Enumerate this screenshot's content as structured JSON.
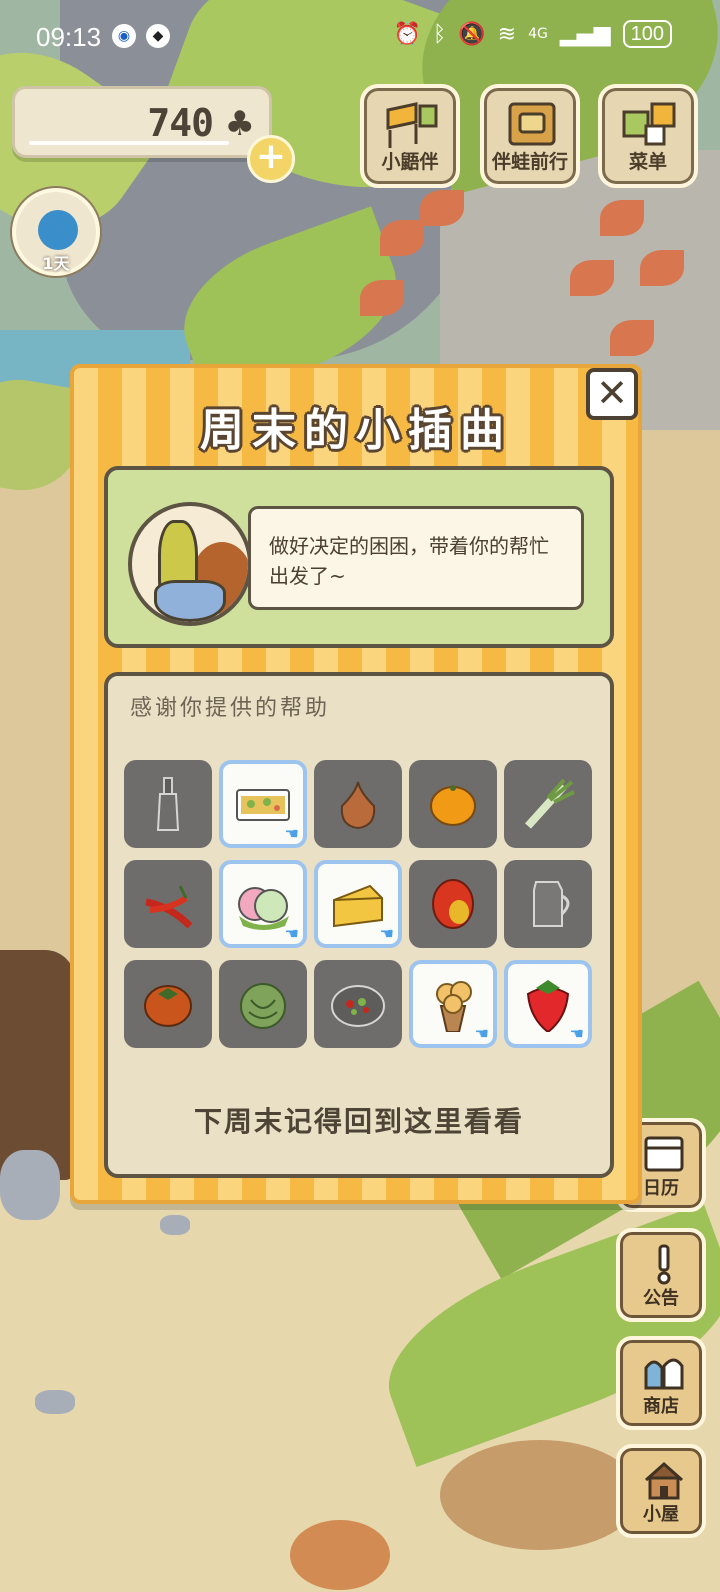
{
  "status_bar": {
    "time": "09:13",
    "app_icons": [
      "browser-icon",
      "qq-icon"
    ],
    "network": "4G",
    "battery": "100"
  },
  "hud": {
    "clover_count": "740",
    "clover_symbol": "♣",
    "plus_symbol": "+",
    "buttons": [
      {
        "label": "小鼯伴",
        "icon": "friends-icon"
      },
      {
        "label": "伴蛙前行",
        "icon": "frog-travel-icon"
      },
      {
        "label": "菜单",
        "icon": "menu-icon"
      }
    ],
    "day_label": "1天"
  },
  "side_buttons": [
    {
      "label": "日历",
      "icon": "calendar-icon"
    },
    {
      "label": "公告",
      "icon": "notice-icon"
    },
    {
      "label": "商店",
      "icon": "shop-icon"
    },
    {
      "label": "小屋",
      "icon": "house-icon"
    }
  ],
  "modal": {
    "title": "周末的小插曲",
    "close_symbol": "✕",
    "dialog_text": "做好决定的困困，带着你的帮忙出发了~",
    "help_heading": "感谢你提供的帮助",
    "footer": "下周末记得回到这里看看",
    "items": [
      {
        "name": "bottle",
        "given": false
      },
      {
        "name": "bento-box",
        "given": true
      },
      {
        "name": "onion",
        "given": false
      },
      {
        "name": "orange",
        "given": false
      },
      {
        "name": "green-onion",
        "given": false
      },
      {
        "name": "red-chili",
        "given": false
      },
      {
        "name": "mochi",
        "given": true
      },
      {
        "name": "cheese",
        "given": true
      },
      {
        "name": "mango",
        "given": false
      },
      {
        "name": "milk-jug",
        "given": false
      },
      {
        "name": "persimmon",
        "given": false
      },
      {
        "name": "cabbage",
        "given": false
      },
      {
        "name": "salad-plate",
        "given": false
      },
      {
        "name": "ice-cream-cone",
        "given": true
      },
      {
        "name": "strawberry",
        "given": true
      }
    ]
  },
  "colors": {
    "modal_stripe_light": "#fbd57e",
    "modal_stripe_dark": "#f6b944",
    "dialog_green": "#cfe09d",
    "given_border": "#9cc4ee",
    "empty_cell": "#6f6d6b"
  }
}
